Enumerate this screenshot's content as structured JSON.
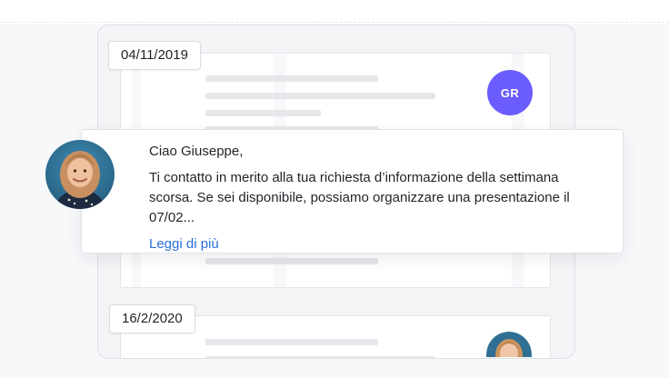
{
  "thread": {
    "first_date": "04/11/2019",
    "second_date": "16/2/2020",
    "sender_initials": "GR"
  },
  "message": {
    "greeting": "Ciao Giuseppe,",
    "body": "Ti contatto in merito alla tua richiesta d’informazione della settimana scorsa. Se sei disponibile, possiamo organizzare una presentazione il 07/02...",
    "read_more": "Leggi di più"
  },
  "colors": {
    "initials_avatar": "#6b5cff",
    "link": "#2a6ed8"
  },
  "icons": {
    "sender_avatar": "woman-portrait-photo",
    "reply_avatar": "woman-portrait-photo"
  }
}
